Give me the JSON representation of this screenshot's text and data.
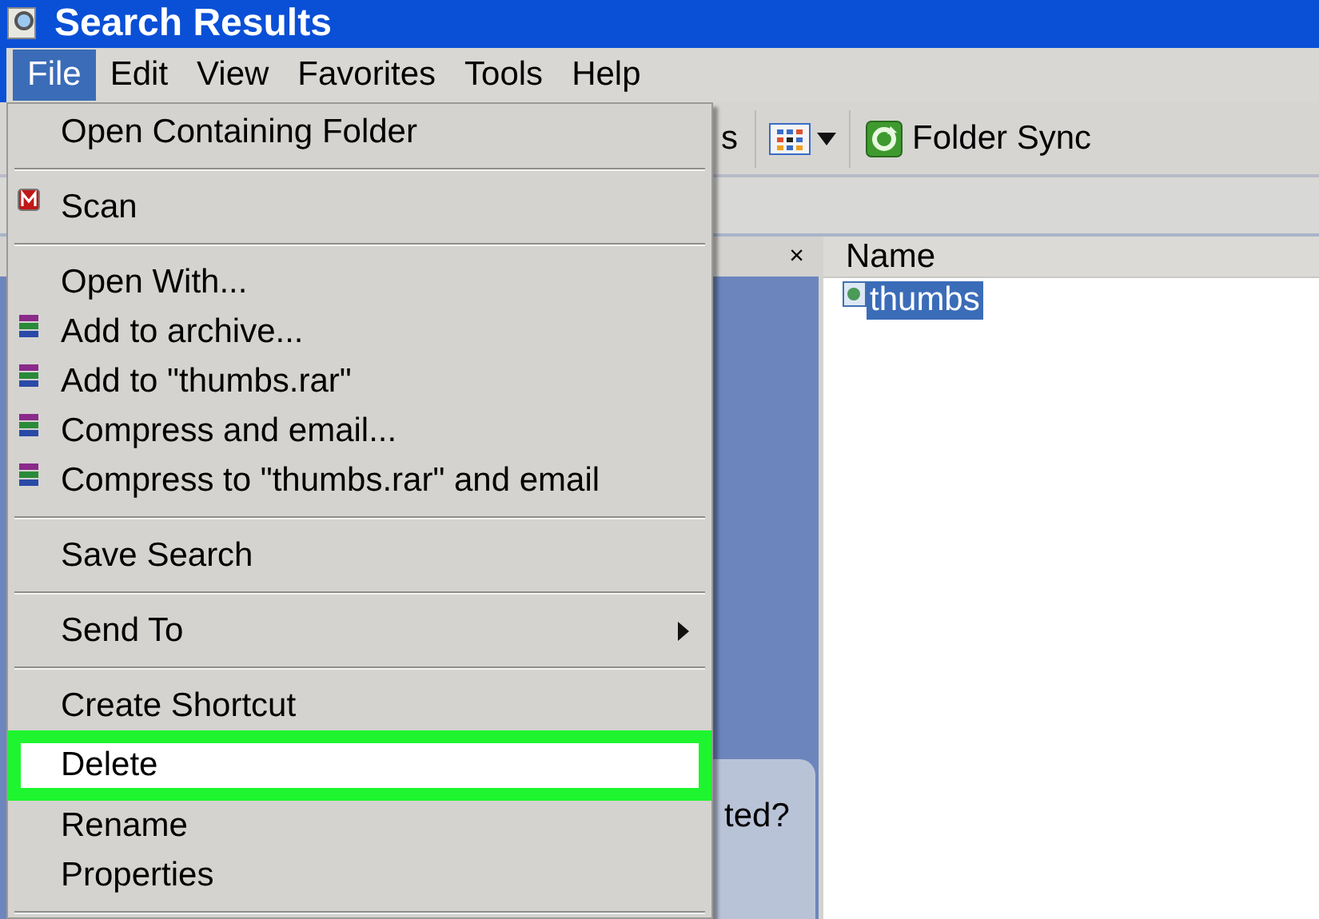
{
  "window": {
    "title": "Search Results"
  },
  "menu_bar": [
    {
      "label": "File",
      "selected": true
    },
    {
      "label": "Edit",
      "selected": false
    },
    {
      "label": "View",
      "selected": false
    },
    {
      "label": "Favorites",
      "selected": false
    },
    {
      "label": "Tools",
      "selected": false
    },
    {
      "label": "Help",
      "selected": false
    }
  ],
  "toolbar": {
    "partial_label": "s",
    "folder_sync": "Folder Sync"
  },
  "left_pane": {
    "close": "×",
    "partial_text": "ted?"
  },
  "file_list": {
    "column": "Name",
    "files": [
      {
        "name": "thumbs",
        "selected": true
      }
    ]
  },
  "file_menu": [
    {
      "kind": "item",
      "label": "Open Containing Folder",
      "selected": false
    },
    {
      "kind": "separator"
    },
    {
      "kind": "scan",
      "label": "Scan",
      "selected": false
    },
    {
      "kind": "separator"
    },
    {
      "kind": "item",
      "label": "Open With...",
      "selected": false
    },
    {
      "kind": "archive",
      "label": "Add to archive...",
      "selected": false
    },
    {
      "kind": "archive",
      "label": "Add to \"thumbs.rar\"",
      "selected": false
    },
    {
      "kind": "archive",
      "label": "Compress and email...",
      "selected": false
    },
    {
      "kind": "archive",
      "label": "Compress to \"thumbs.rar\" and email",
      "selected": false
    },
    {
      "kind": "separator"
    },
    {
      "kind": "item",
      "label": "Save Search",
      "selected": false
    },
    {
      "kind": "separator"
    },
    {
      "kind": "item",
      "label": "Send To",
      "submenu": true,
      "selected": false
    },
    {
      "kind": "separator"
    },
    {
      "kind": "item",
      "label": "Create Shortcut",
      "selected": false
    },
    {
      "kind": "item",
      "label": "Delete",
      "selected": true
    },
    {
      "kind": "item",
      "label": "Rename",
      "selected": false
    },
    {
      "kind": "item",
      "label": "Properties",
      "selected": false
    },
    {
      "kind": "separator"
    }
  ]
}
